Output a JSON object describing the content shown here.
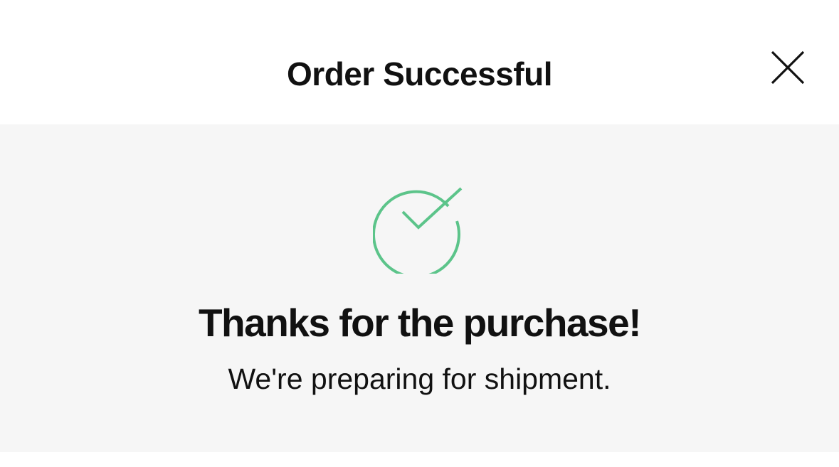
{
  "header": {
    "title": "Order Successful",
    "close_icon": "close-icon"
  },
  "content": {
    "icon": "check-circle-icon",
    "icon_color": "#5cc48a",
    "heading": "Thanks for the purchase!",
    "message": "We're preparing for shipment."
  },
  "colors": {
    "background": "#ffffff",
    "content_background": "#f6f6f6",
    "text": "#111111"
  }
}
